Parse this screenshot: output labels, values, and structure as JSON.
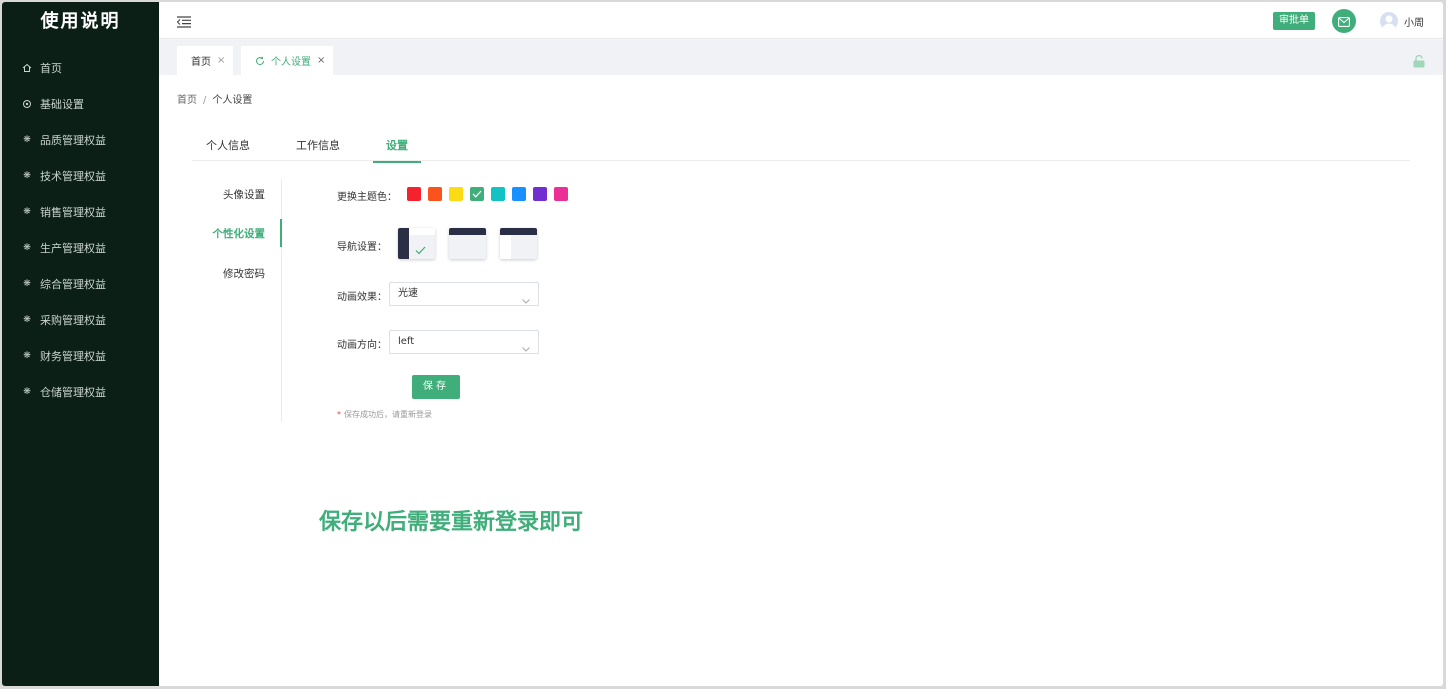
{
  "app": {
    "title": "使用说明"
  },
  "sidebar": {
    "items": [
      {
        "label": "首页",
        "icon": "home-icon"
      },
      {
        "label": "基础设置",
        "icon": "settings-icon"
      },
      {
        "label": "品质管理权益",
        "icon": "gear-icon"
      },
      {
        "label": "技术管理权益",
        "icon": "gear-icon"
      },
      {
        "label": "销售管理权益",
        "icon": "gear-icon"
      },
      {
        "label": "生产管理权益",
        "icon": "gear-icon"
      },
      {
        "label": "综合管理权益",
        "icon": "gear-icon"
      },
      {
        "label": "采购管理权益",
        "icon": "gear-icon"
      },
      {
        "label": "财务管理权益",
        "icon": "gear-icon"
      },
      {
        "label": "仓储管理权益",
        "icon": "gear-icon"
      }
    ]
  },
  "header": {
    "approve_label": "审批单",
    "username": "小周",
    "accent": "#3fae7a"
  },
  "tabs": [
    {
      "label": "首页",
      "close": "×"
    },
    {
      "label": "个人设置",
      "close": "×",
      "active": true
    }
  ],
  "breadcrumb": {
    "home": "首页",
    "sep": "/",
    "current": "个人设置"
  },
  "profile_tabs": [
    {
      "label": "个人信息"
    },
    {
      "label": "工作信息"
    },
    {
      "label": "设置",
      "active": true
    }
  ],
  "settings_menu": [
    {
      "label": "头像设置"
    },
    {
      "label": "个性化设置",
      "active": true
    },
    {
      "label": "修改密码"
    }
  ],
  "form": {
    "theme_label": "更换主题色：",
    "theme_colors": [
      "#f5222d",
      "#fa541c",
      "#fadb14",
      "#3fae7a",
      "#13c2c2",
      "#1890ff",
      "#722ed1",
      "#eb2f96"
    ],
    "theme_selected_index": 3,
    "nav_label": "导航设置：",
    "nav_selected_index": 0,
    "anim_effect_label": "动画效果：",
    "anim_effect_value": "光速",
    "anim_dir_label": "动画方向：",
    "anim_dir_value": "left",
    "save_label": "保存",
    "note_star": "*",
    "note_text": "保存成功后，请重新登录"
  },
  "caption": "保存以后需要重新登录即可"
}
